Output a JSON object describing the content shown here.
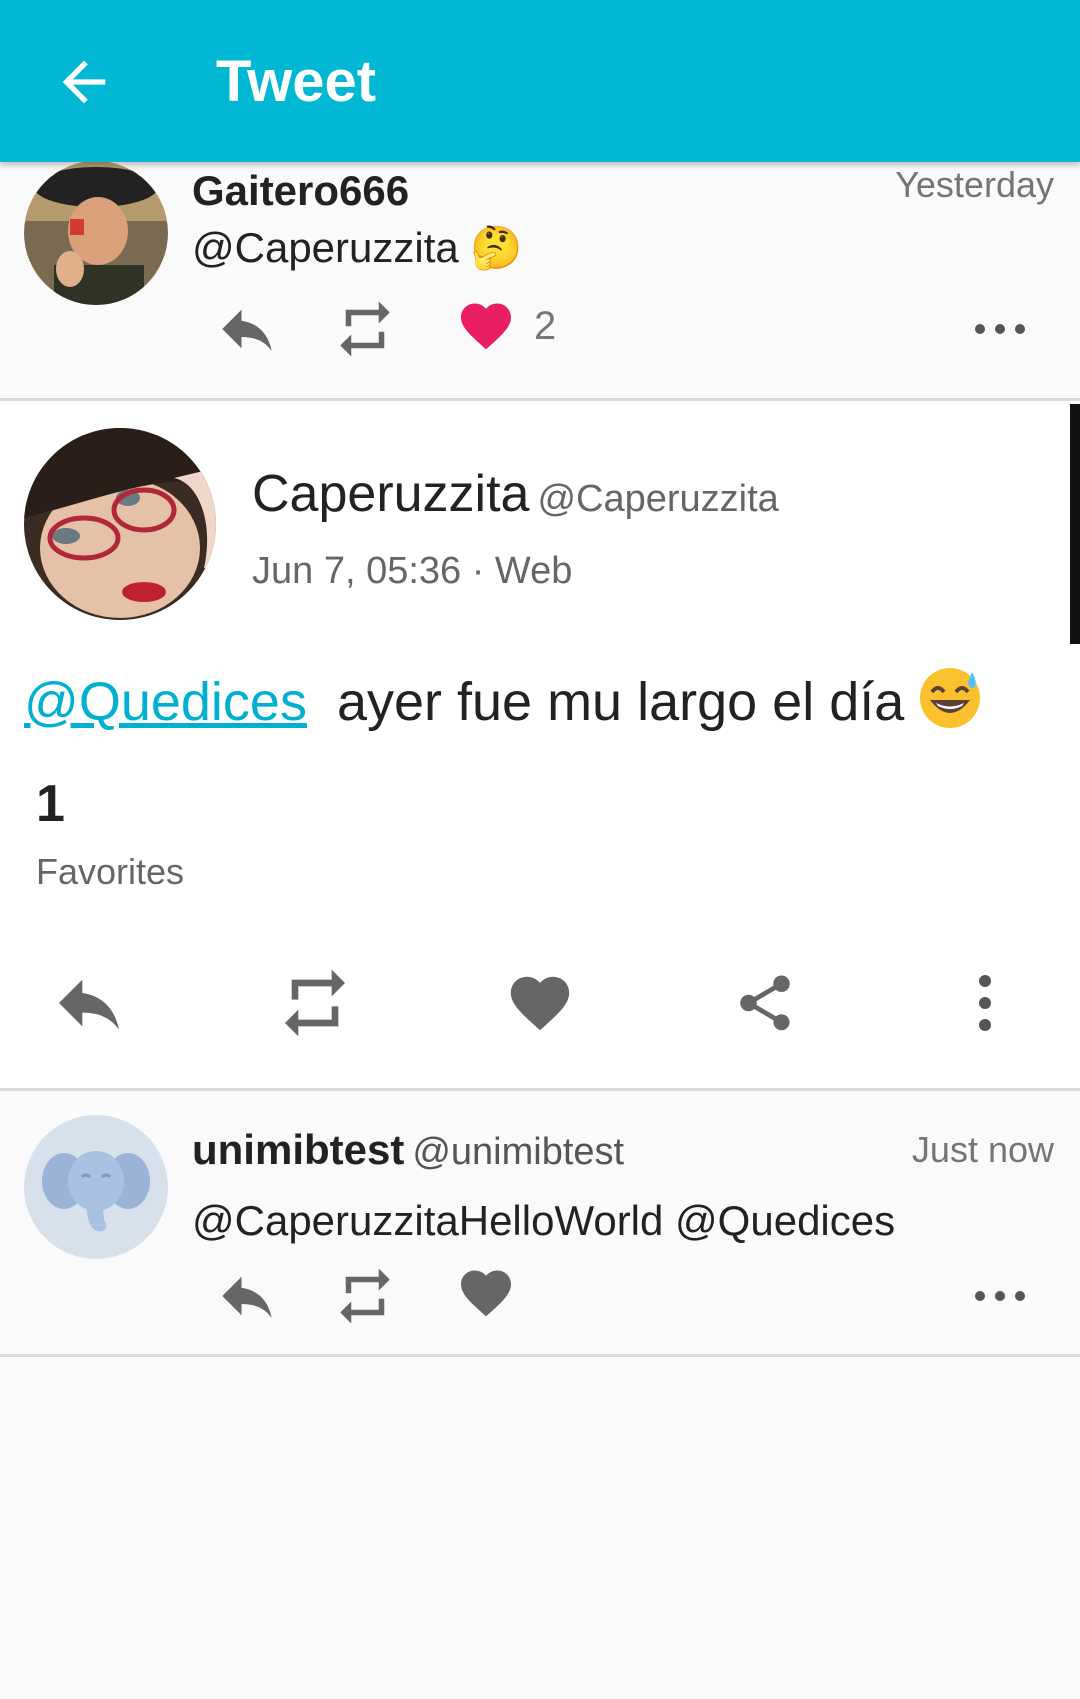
{
  "appbar": {
    "title": "Tweet",
    "back_icon": "arrow-back-icon"
  },
  "colors": {
    "accent": "#00b8d4",
    "like_active": "#e91e63",
    "mention": "#00b0d0"
  },
  "reply_above": {
    "name": "Gaitero666",
    "time": "Yesterday",
    "text": "@Caperuzzita 🤔",
    "like_count": "2"
  },
  "main_tweet": {
    "name": "Caperuzzita",
    "handle": "@Caperuzzita",
    "meta": "Jun 7, 05:36 · Web",
    "mention": "@Quedices",
    "text": "ayer fue mu largo el día",
    "favorites_count": "1",
    "favorites_label": "Favorites"
  },
  "reply_below": {
    "name": "unimibtest",
    "handle": "@unimibtest",
    "time": "Just now",
    "text": "@CaperuzzitaHelloWorld @Quedices"
  }
}
